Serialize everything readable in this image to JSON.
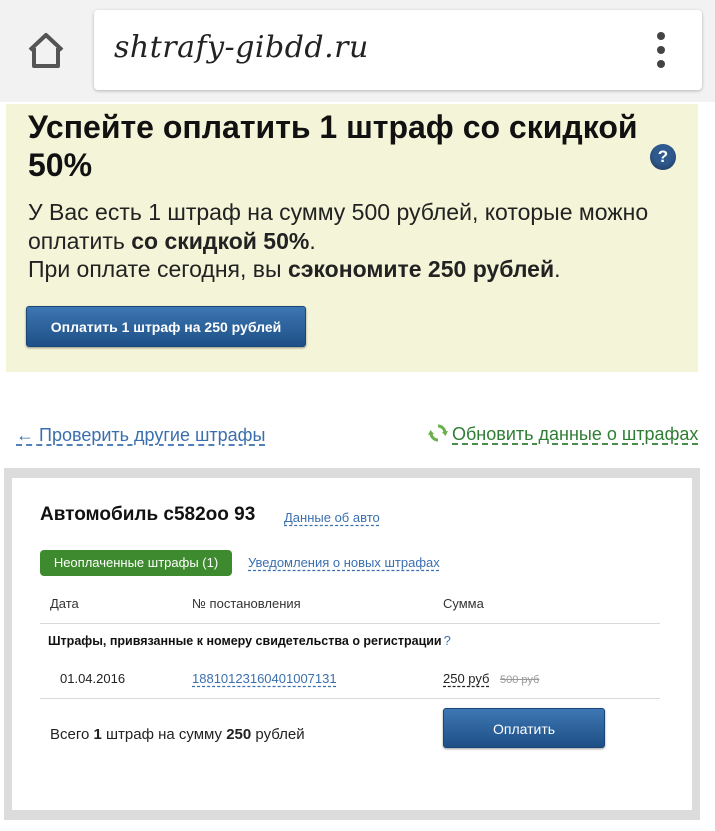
{
  "browser": {
    "url": "shtrafy-gibdd.ru",
    "home_icon": "home-icon",
    "menu_icon": "kebab-menu-icon"
  },
  "promo": {
    "title": "Успейте оплатить 1 штраф со скидкой 50%",
    "help_label": "?",
    "line1_pre": "У Вас есть 1 штраф на сумму 500 рублей, которые можно оплатить ",
    "line1_bold": "со скидкой 50%",
    "line1_post": ".",
    "line2_pre": "При оплате сегодня, вы ",
    "line2_bold": "сэкономите 250 рублей",
    "line2_post": ".",
    "button_label": "Оплатить 1 штраф на 250 рублей",
    "background": "#f4f4d8"
  },
  "links": {
    "back": "← Проверить другие штрафы",
    "refresh": "Обновить данные о штрафах",
    "refresh_icon": "refresh-icon"
  },
  "car": {
    "title": "Автомобиль с582оо 93",
    "details_link": "Данные об авто",
    "tabs": [
      {
        "label": "Неоплаченные штрафы (1)",
        "active": true
      },
      {
        "label": "Уведомления о новых штрафах",
        "active": false
      }
    ],
    "table": {
      "headers": [
        "Дата",
        "№ постановления",
        "Сумма"
      ],
      "group_label": "Штрафы, привязанные к номеру свидетельства о регистрации",
      "group_help": "?",
      "rows": [
        {
          "date": "01.04.2016",
          "decree": "18810123160401007131",
          "sum": "250 руб",
          "old_sum": "500 руб"
        }
      ]
    },
    "total_pre": "Всего ",
    "total_count": "1",
    "total_mid": " штраф на сумму ",
    "total_sum": "250",
    "total_post": " рублей",
    "pay_button": "Оплатить"
  },
  "colors": {
    "accent_blue": "#2f5f98",
    "link_blue": "#3a6fae",
    "green": "#3e8a2e"
  }
}
